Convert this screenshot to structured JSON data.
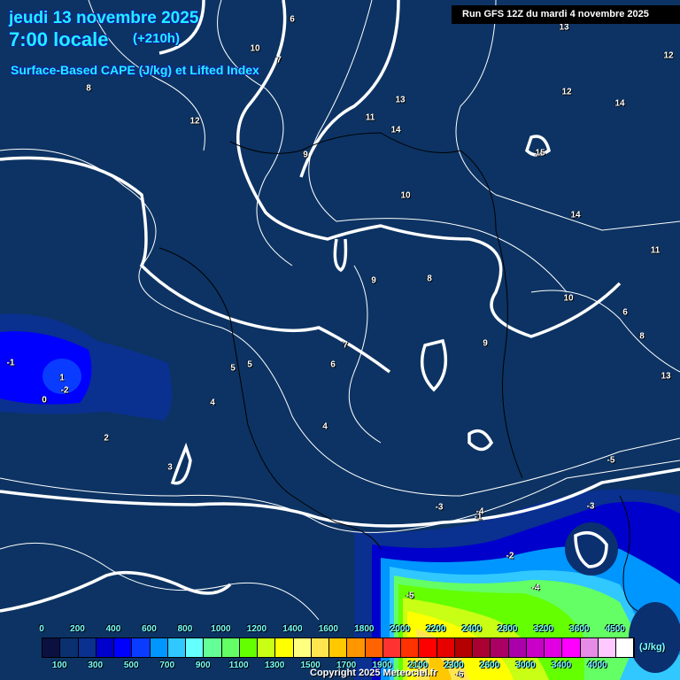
{
  "header": {
    "date": "jeudi 13 novembre 2025",
    "time": "7:00 locale",
    "lead": "(+210h)",
    "parameter": "Surface-Based CAPE (J/kg) et Lifted Index",
    "run": "Run GFS 12Z du mardi 4 novembre 2025"
  },
  "legend": {
    "unit": "(J/kg)",
    "colors": [
      "#0a1040",
      "#0a3070",
      "#0a3090",
      "#0000cc",
      "#0000ff",
      "#0a3cff",
      "#0096ff",
      "#30c8ff",
      "#64ffff",
      "#64ff96",
      "#64ff64",
      "#64ff00",
      "#c8ff14",
      "#ffff00",
      "#ffff80",
      "#ffe650",
      "#ffc800",
      "#ff9600",
      "#ff6400",
      "#ff3232",
      "#ff3200",
      "#ff0000",
      "#e60000",
      "#b40000",
      "#aa0032",
      "#aa0064",
      "#aa00aa",
      "#c800c8",
      "#e100e1",
      "#ff00ff",
      "#e68ce6",
      "#ffc8ff",
      "#ffffff"
    ],
    "top_labels": [
      "0",
      "200",
      "400",
      "600",
      "800",
      "1000",
      "1200",
      "1400",
      "1600",
      "1800",
      "2000",
      "2200",
      "2400",
      "2800",
      "3200",
      "3600",
      "4500"
    ],
    "bottom_labels": [
      "100",
      "300",
      "500",
      "700",
      "900",
      "1100",
      "1300",
      "1500",
      "1700",
      "1900",
      "2100",
      "2300",
      "2600",
      "3000",
      "3400",
      "4000"
    ]
  },
  "lifted_index_labels": [
    "6",
    "10",
    "8",
    "7",
    "12",
    "13",
    "11",
    "9",
    "14",
    "13",
    "15",
    "14",
    "12",
    "10",
    "8",
    "9",
    "7",
    "6",
    "5",
    "4",
    "3",
    "2",
    "1",
    "0",
    "-1",
    "-2",
    "-3",
    "-4",
    "-5",
    "13",
    "12",
    "14",
    "11",
    "10",
    "8",
    "9",
    "6",
    "5",
    "4",
    "-1",
    "-2",
    "-3",
    "-4",
    "-5",
    "-6"
  ],
  "copyright": "Copyright 2025 Meteociel.fr"
}
